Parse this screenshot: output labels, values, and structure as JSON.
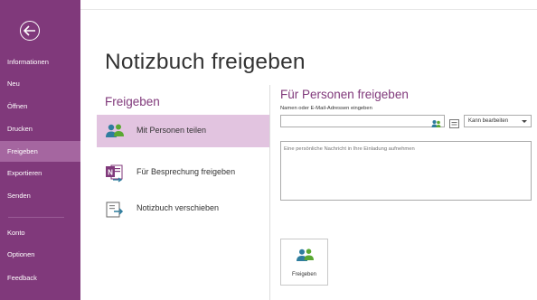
{
  "nav": {
    "back_icon": "back-arrow-icon",
    "items": [
      {
        "label": "Informationen"
      },
      {
        "label": "Neu"
      },
      {
        "label": "Öffnen"
      },
      {
        "label": "Drucken"
      },
      {
        "label": "Freigeben",
        "active": true
      },
      {
        "label": "Exportieren"
      },
      {
        "label": "Senden"
      },
      {
        "label": "Konto"
      },
      {
        "label": "Optionen"
      },
      {
        "label": "Feedback"
      }
    ],
    "colors": {
      "background": "#80397b",
      "active": "#a566a0"
    }
  },
  "main": {
    "title": "Notizbuch freigeben",
    "section_heading": "Freigeben",
    "options": [
      {
        "label": "Mit Personen teilen",
        "icon": "people-icon",
        "selected": true
      },
      {
        "label": "Für Besprechung freigeben",
        "icon": "onenote-meeting-icon"
      },
      {
        "label": "Notizbuch verschieben",
        "icon": "move-notebook-icon"
      }
    ]
  },
  "share_panel": {
    "heading": "Für Personen freigeben",
    "names_label": "Namen oder E-Mail-Adressen eingeben",
    "names_value": "",
    "permission": "Kann bearbeiten",
    "message_placeholder": "Eine persönliche Nachricht in Ihre Einladung aufnehmen",
    "share_button": "Freigeben",
    "accent": "#80397b"
  }
}
